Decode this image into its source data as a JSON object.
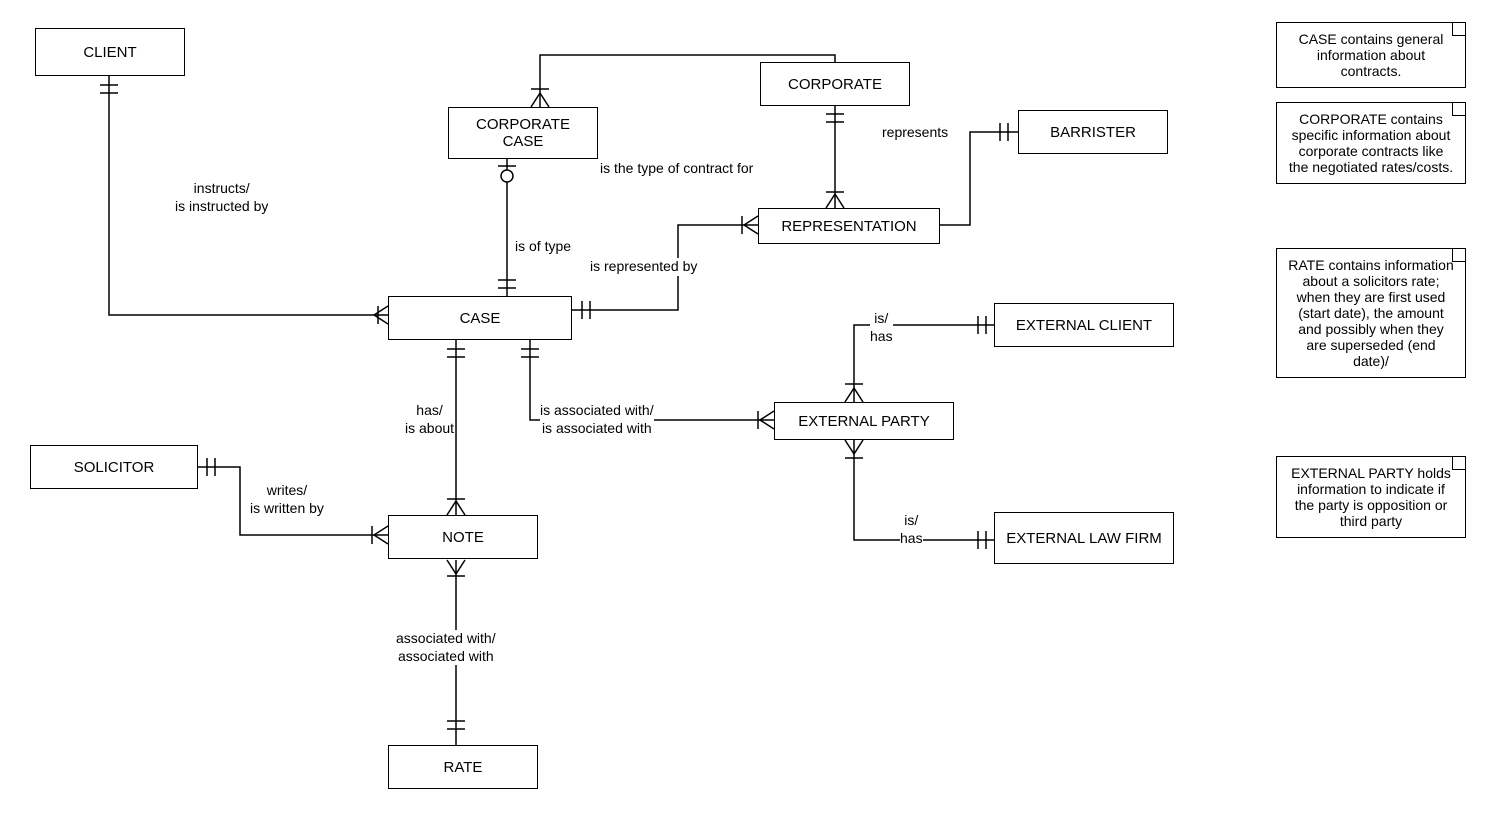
{
  "entities": {
    "client": "CLIENT",
    "corporate_case": "CORPORATE CASE",
    "corporate": "CORPORATE",
    "barrister": "BARRISTER",
    "representation": "REPRESENTATION",
    "case": "CASE",
    "external_client": "EXTERNAL CLIENT",
    "external_party": "EXTERNAL PARTY",
    "external_law_firm": "EXTERNAL LAW FIRM",
    "solicitor": "SOLICITOR",
    "note": "NOTE",
    "rate": "RATE"
  },
  "labels": {
    "instructs": "instructs/\nis instructed by",
    "is_of_type": "is of type",
    "is_type_contract": "is the type of contract for",
    "represents": "represents",
    "is_represented_by": "is represented by",
    "is_has_ec": "is/\nhas",
    "is_has_elf": "is/\nhas",
    "is_associated_with": "is associated with/\nis associated with",
    "has_is_about": "has/\nis about",
    "writes": "writes/\nis written by",
    "assoc_rate": "associated with/\nassociated with"
  },
  "notes": {
    "n1": "CASE contains general information about contracts.",
    "n2": "CORPORATE contains specific information about corporate contracts like the negotiated rates/costs.",
    "n3": "RATE contains information about a solicitors rate; when they are first used (start date), the amount and possibly when they are superseded (end date)/",
    "n4": "EXTERNAL PARTY holds information to indicate if the party is opposition or third party"
  }
}
